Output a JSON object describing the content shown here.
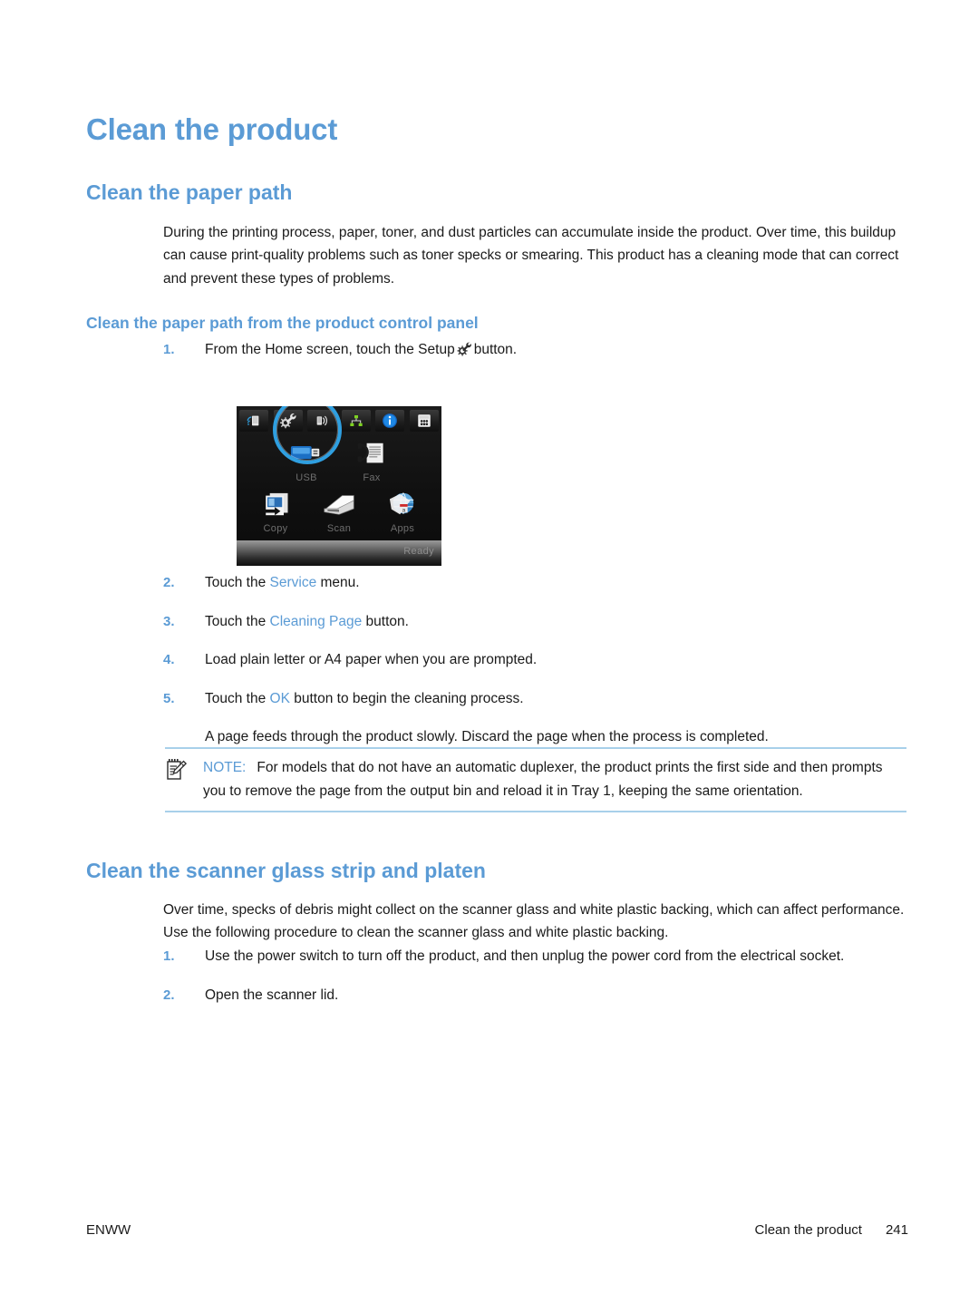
{
  "document": {
    "title": "Clean the product",
    "sections": [
      {
        "heading": "Clean the paper path",
        "intro": "During the printing process, paper, toner, and dust particles can accumulate inside the product. Over time, this buildup can cause print-quality problems such as toner specks or smearing. This product has a cleaning mode that can correct and prevent these types of problems.",
        "subheading": "Clean the paper path from the product control panel"
      },
      {
        "heading": "Clean the scanner glass strip and platen",
        "intro": "Over time, specks of debris might collect on the scanner glass and white plastic backing, which can affect performance. Use the following procedure to clean the scanner glass and white plastic backing."
      }
    ]
  },
  "steps_control_panel": [
    {
      "num": "1.",
      "text_before": "From the Home screen, touch the Setup",
      "icon": "setup-wrench-gear-icon",
      "text_after": "button."
    }
  ],
  "steps_after_image": [
    {
      "num": "2.",
      "text_before": "Touch the ",
      "ui_ref": "Service",
      "text_after": " menu."
    },
    {
      "num": "3.",
      "text_before": "Touch the ",
      "ui_ref": "Cleaning Page",
      "text_after": " button."
    },
    {
      "num": "4.",
      "text_before": "Load plain letter or A4 paper when you are prompted.",
      "ui_ref": "",
      "text_after": ""
    },
    {
      "num": "5.",
      "text_before": "Touch the ",
      "ui_ref": "OK",
      "text_after": " button to begin the cleaning process."
    }
  ],
  "steps_after_image_trailing": "A page feeds through the product slowly. Discard the page when the process is completed.",
  "steps_scanner": [
    {
      "num": "1.",
      "text": "Use the power switch to turn off the product, and then unplug the power cord from the electrical socket."
    },
    {
      "num": "2.",
      "text": "Open the scanner lid."
    }
  ],
  "note": {
    "label": "NOTE:",
    "text": "For models that do not have an automatic duplexer, the product prints the first side and then prompts you to remove the page from the output bin and reload it in Tray 1, keeping the same orientation.",
    "icon": "note-pad-pencil-icon"
  },
  "control_panel": {
    "caption_alt": "Product control panel Home screen with the Setup button highlighted",
    "top_icons": [
      "wireless-direct-icon",
      "setup-wrench-gear-icon",
      "wireless-signal-icon",
      "network-icon",
      "information-icon",
      "supplies-status-icon"
    ],
    "tiles": [
      {
        "label": "USB",
        "icon": "usb-drive-icon"
      },
      {
        "label": "Fax",
        "icon": "fax-icon"
      },
      {
        "label": "Copy",
        "icon": "copy-icon"
      },
      {
        "label": "Scan",
        "icon": "scan-icon"
      },
      {
        "label": "Apps",
        "icon": "apps-globe-icon"
      }
    ],
    "status_text": "Ready",
    "callout_color": "#2f9fe0",
    "highlighted_button": "setup-wrench-gear-icon"
  },
  "footer": {
    "left": "ENWW",
    "section": "Clean the product",
    "page_number": "241"
  },
  "colors": {
    "heading_blue": "#5b9bd5",
    "ui_reference_blue": "#5b9bd5",
    "note_rule": "#a8d0ea",
    "body_text": "#1a1a1a"
  }
}
